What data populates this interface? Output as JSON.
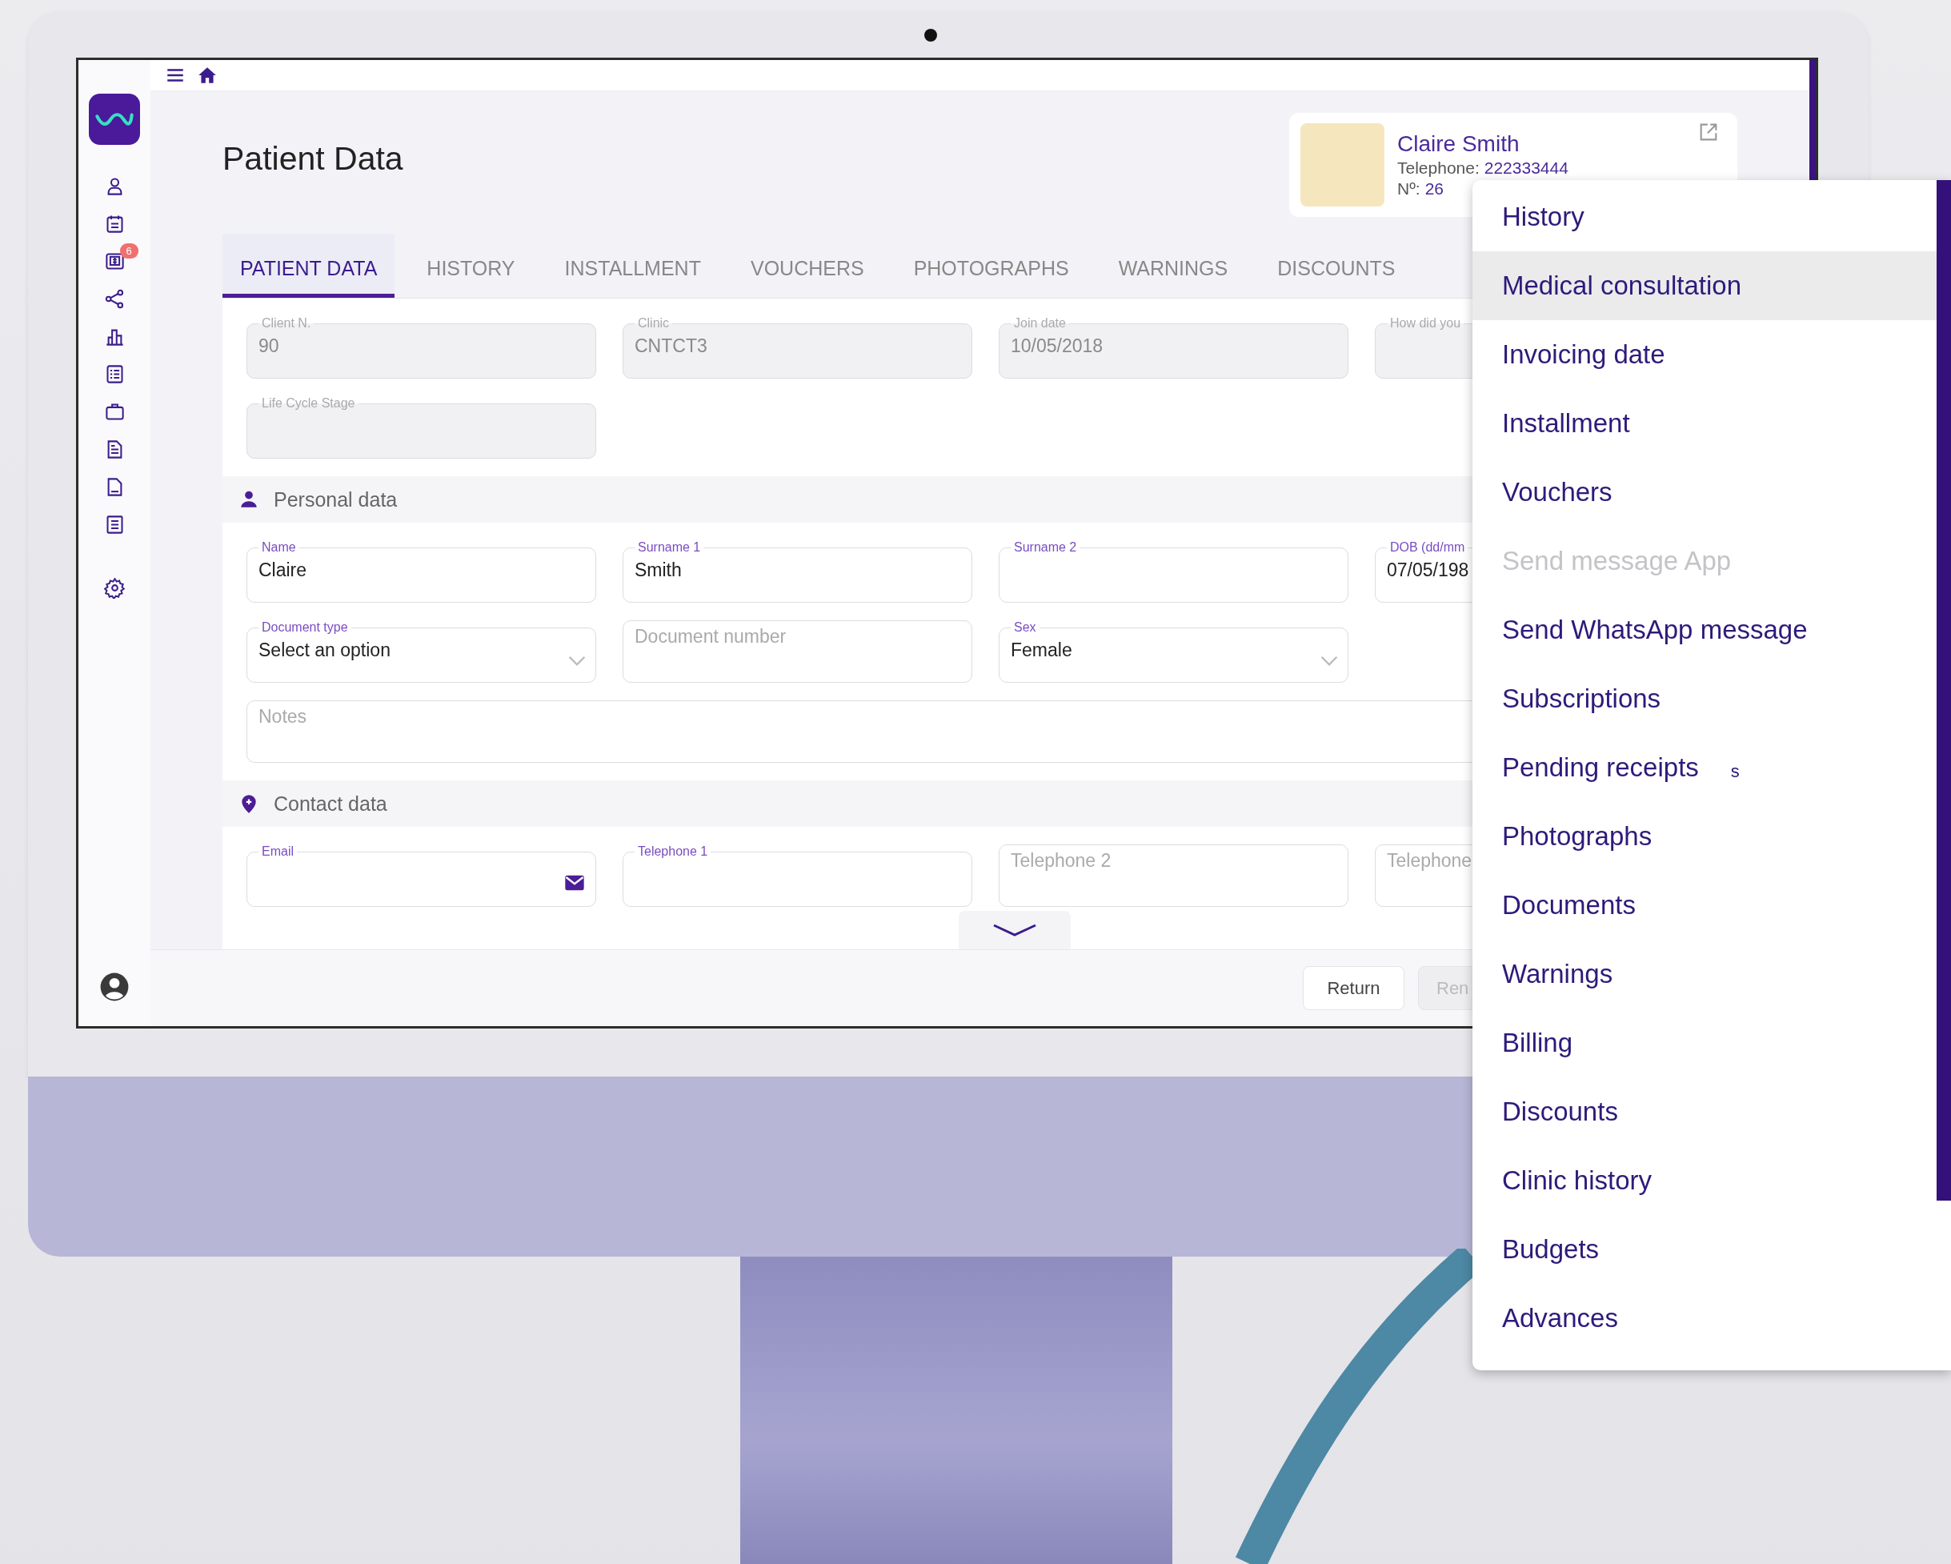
{
  "sidebar": {
    "notification_badge": "6"
  },
  "page": {
    "title": "Patient Data"
  },
  "patient_card": {
    "name": "Claire Smith",
    "telephone_label": "Telephone:",
    "telephone": "222333444",
    "number_label": "Nº:",
    "number": "26"
  },
  "tabs": [
    {
      "label": "PATIENT DATA",
      "selected": true
    },
    {
      "label": "HISTORY",
      "selected": false
    },
    {
      "label": "INSTALLMENT",
      "selected": false
    },
    {
      "label": "VOUCHERS",
      "selected": false
    },
    {
      "label": "PHOTOGRAPHS",
      "selected": false
    },
    {
      "label": "WARNINGS",
      "selected": false
    },
    {
      "label": "DISCOUNTS",
      "selected": false
    }
  ],
  "general_fields": [
    {
      "label": "Client N.",
      "value": "90",
      "disabled": true
    },
    {
      "label": "Clinic",
      "value": "CNTCT3",
      "disabled": true
    },
    {
      "label": "Join date",
      "value": "10/05/2018",
      "disabled": true
    },
    {
      "label": "How did you",
      "disabled": true
    },
    {
      "label": "Life Cycle Stage",
      "disabled": true
    }
  ],
  "sections": [
    {
      "kind": "person",
      "title": "Personal data",
      "fields": [
        {
          "kind": "text",
          "label": "Name",
          "value": "Claire",
          "disabled": false
        },
        {
          "kind": "text",
          "label": "Surname 1",
          "value": "Smith",
          "disabled": false
        },
        {
          "kind": "text",
          "label": "Surname 2",
          "disabled": false
        },
        {
          "kind": "text",
          "label": "DOB (dd/mm",
          "value": "07/05/198",
          "disabled": false
        },
        {
          "kind": "select",
          "label": "Document type",
          "value": "Select an option",
          "disabled": false
        },
        {
          "kind": "text",
          "placeholder": "Document number",
          "disabled": false
        },
        {
          "kind": "select",
          "label": "Sex",
          "value": "Female",
          "disabled": false
        },
        {
          "kind": "notes",
          "placeholder": "Notes",
          "disabled": false
        }
      ]
    },
    {
      "kind": "location",
      "title": "Contact data",
      "fields": [
        {
          "kind": "email",
          "label": "Email",
          "disabled": false
        },
        {
          "kind": "text",
          "label": "Telephone 1",
          "disabled": false
        },
        {
          "kind": "text",
          "placeholder": "Telephone 2",
          "disabled": false
        },
        {
          "kind": "text",
          "placeholder": "Telephone",
          "disabled": false
        }
      ]
    }
  ],
  "footer_buttons": [
    {
      "label": "Return",
      "disabled": false
    },
    {
      "label": "Ren",
      "disabled": true
    }
  ],
  "context_menu": [
    {
      "label": "History",
      "selected": false,
      "disabled": false
    },
    {
      "label": "Medical consultation",
      "selected": true,
      "disabled": false
    },
    {
      "label": "Invoicing date",
      "selected": false,
      "disabled": false
    },
    {
      "label": "Installment",
      "selected": false,
      "disabled": false
    },
    {
      "label": "Vouchers",
      "selected": false,
      "disabled": false
    },
    {
      "label": "Send message App",
      "selected": false,
      "disabled": true
    },
    {
      "label": "Send WhatsApp message",
      "selected": false,
      "disabled": false
    },
    {
      "label": "Subscriptions",
      "selected": false,
      "disabled": false
    },
    {
      "label": "Pending receipts",
      "suffix": "s",
      "selected": false,
      "disabled": false
    },
    {
      "label": "Photographs",
      "selected": false,
      "disabled": false
    },
    {
      "label": "Documents",
      "selected": false,
      "disabled": false
    },
    {
      "label": "Warnings",
      "selected": false,
      "disabled": false
    },
    {
      "label": "Billing",
      "selected": false,
      "disabled": false
    },
    {
      "label": "Discounts",
      "selected": false,
      "disabled": false
    },
    {
      "label": "Clinic history",
      "selected": false,
      "disabled": false
    },
    {
      "label": "Budgets",
      "selected": false,
      "disabled": false
    },
    {
      "label": "Advances",
      "selected": false,
      "disabled": false
    }
  ]
}
